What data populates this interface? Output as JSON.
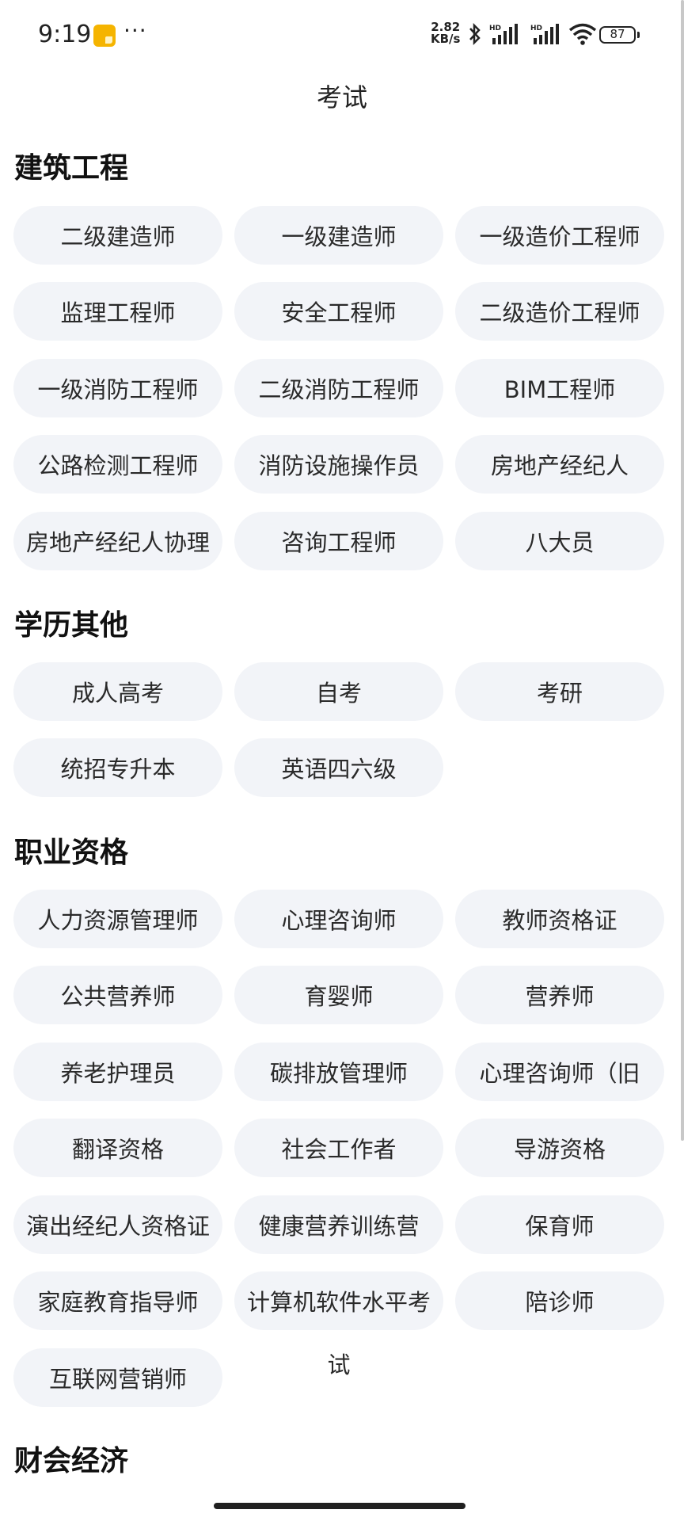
{
  "status_bar": {
    "time": "9:19",
    "more": "···",
    "net_speed_value": "2.82",
    "net_speed_unit": "KB/s",
    "battery": "87"
  },
  "page_title": "考试",
  "sections": [
    {
      "title": "建筑工程",
      "items": [
        "二级建造师",
        "一级建造师",
        "一级造价工程师",
        "监理工程师",
        "安全工程师",
        "二级造价工程师",
        "一级消防工程师",
        "二级消防工程师",
        "BIM工程师",
        "公路检测工程师",
        "消防设施操作员",
        "房地产经纪人",
        "房地产经纪人协理",
        "咨询工程师",
        "八大员"
      ]
    },
    {
      "title": "学历其他",
      "items": [
        "成人高考",
        "自考",
        "考研",
        "统招专升本",
        "英语四六级"
      ]
    },
    {
      "title": "职业资格",
      "items": [
        "人力资源管理师",
        "心理咨询师",
        "教师资格证",
        "公共营养师",
        "育婴师",
        "营养师",
        "养老护理员",
        "碳排放管理师",
        "心理咨询师（旧",
        "翻译资格",
        "社会工作者",
        "导游资格",
        "演出经纪人资格证",
        "健康营养训练营",
        "保育师",
        "家庭教育指导师",
        "计算机软件水平考试",
        "陪诊师",
        "互联网营销师"
      ]
    },
    {
      "title": "财会经济",
      "items": []
    }
  ],
  "wrapped_item": {
    "line1": "计算机软件水平考",
    "line2": "试"
  }
}
